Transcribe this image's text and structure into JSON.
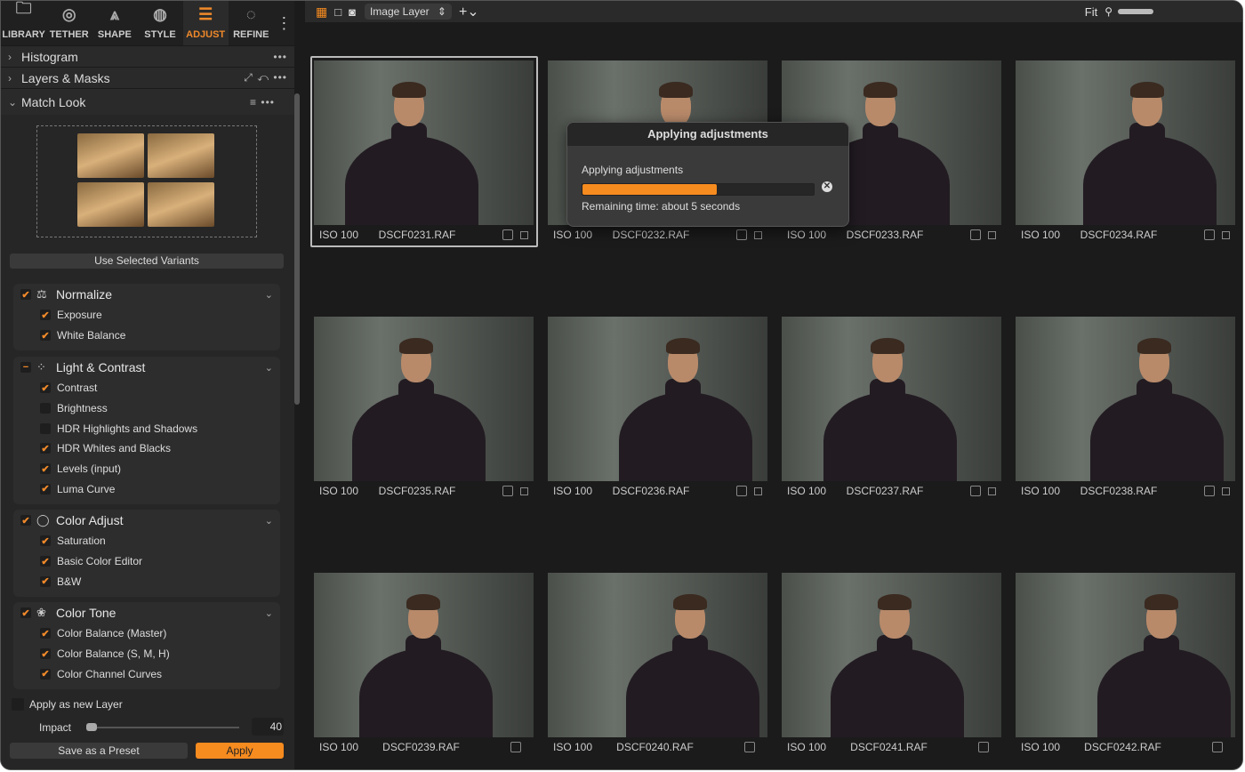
{
  "tabs": [
    {
      "label": "LIBRARY",
      "icon": "folder-icon"
    },
    {
      "label": "TETHER",
      "icon": "camera-icon"
    },
    {
      "label": "SHAPE",
      "icon": "compass-icon"
    },
    {
      "label": "STYLE",
      "icon": "style-icon"
    },
    {
      "label": "ADJUST",
      "icon": "sliders-icon",
      "active": true
    },
    {
      "label": "REFINE",
      "icon": "refine-icon"
    }
  ],
  "sections": {
    "histogram": "Histogram",
    "layers": "Layers & Masks",
    "match_look": "Match Look"
  },
  "use_selected": "Use Selected Variants",
  "groups": [
    {
      "label": "Normalize",
      "state": "checked",
      "items": [
        {
          "label": "Exposure",
          "checked": true
        },
        {
          "label": "White Balance",
          "checked": true
        }
      ]
    },
    {
      "label": "Light & Contrast",
      "state": "mixed",
      "items": [
        {
          "label": "Contrast",
          "checked": true
        },
        {
          "label": "Brightness",
          "checked": false
        },
        {
          "label": "HDR Highlights and Shadows",
          "checked": false
        },
        {
          "label": "HDR Whites and Blacks",
          "checked": true
        },
        {
          "label": "Levels (input)",
          "checked": true
        },
        {
          "label": "Luma Curve",
          "checked": true
        }
      ]
    },
    {
      "label": "Color Adjust",
      "state": "checked",
      "items": [
        {
          "label": "Saturation",
          "checked": true
        },
        {
          "label": "Basic Color Editor",
          "checked": true
        },
        {
          "label": "B&W",
          "checked": true
        }
      ]
    },
    {
      "label": "Color Tone",
      "state": "checked",
      "items": [
        {
          "label": "Color Balance (Master)",
          "checked": true
        },
        {
          "label": "Color Balance (S, M, H)",
          "checked": true
        },
        {
          "label": "Color Channel Curves",
          "checked": true
        }
      ]
    }
  ],
  "apply_new_layer": {
    "label": "Apply as new Layer",
    "checked": false
  },
  "impact": {
    "label": "Impact",
    "value": "40"
  },
  "buttons": {
    "save_preset": "Save as a Preset",
    "apply": "Apply"
  },
  "toolbar": {
    "layer_select": "Image Layer",
    "fit": "Fit"
  },
  "accent": "#f68b1f",
  "images": [
    {
      "iso": "ISO 100",
      "file": "DSCF0231.RAF",
      "selected": true
    },
    {
      "iso": "ISO 100",
      "file": "DSCF0232.RAF"
    },
    {
      "iso": "ISO 100",
      "file": "DSCF0233.RAF"
    },
    {
      "iso": "ISO 100",
      "file": "DSCF0234.RAF"
    },
    {
      "iso": "ISO 100",
      "file": "DSCF0235.RAF"
    },
    {
      "iso": "ISO 100",
      "file": "DSCF0236.RAF"
    },
    {
      "iso": "ISO 100",
      "file": "DSCF0237.RAF"
    },
    {
      "iso": "ISO 100",
      "file": "DSCF0238.RAF"
    },
    {
      "iso": "ISO 100",
      "file": "DSCF0239.RAF"
    },
    {
      "iso": "ISO 100",
      "file": "DSCF0240.RAF"
    },
    {
      "iso": "ISO 100",
      "file": "DSCF0241.RAF"
    },
    {
      "iso": "ISO 100",
      "file": "DSCF0242.RAF"
    }
  ],
  "dialog": {
    "title": "Applying adjustments",
    "message": "Applying adjustments",
    "progress": 0.58,
    "remaining": "Remaining time: about 5 seconds"
  }
}
